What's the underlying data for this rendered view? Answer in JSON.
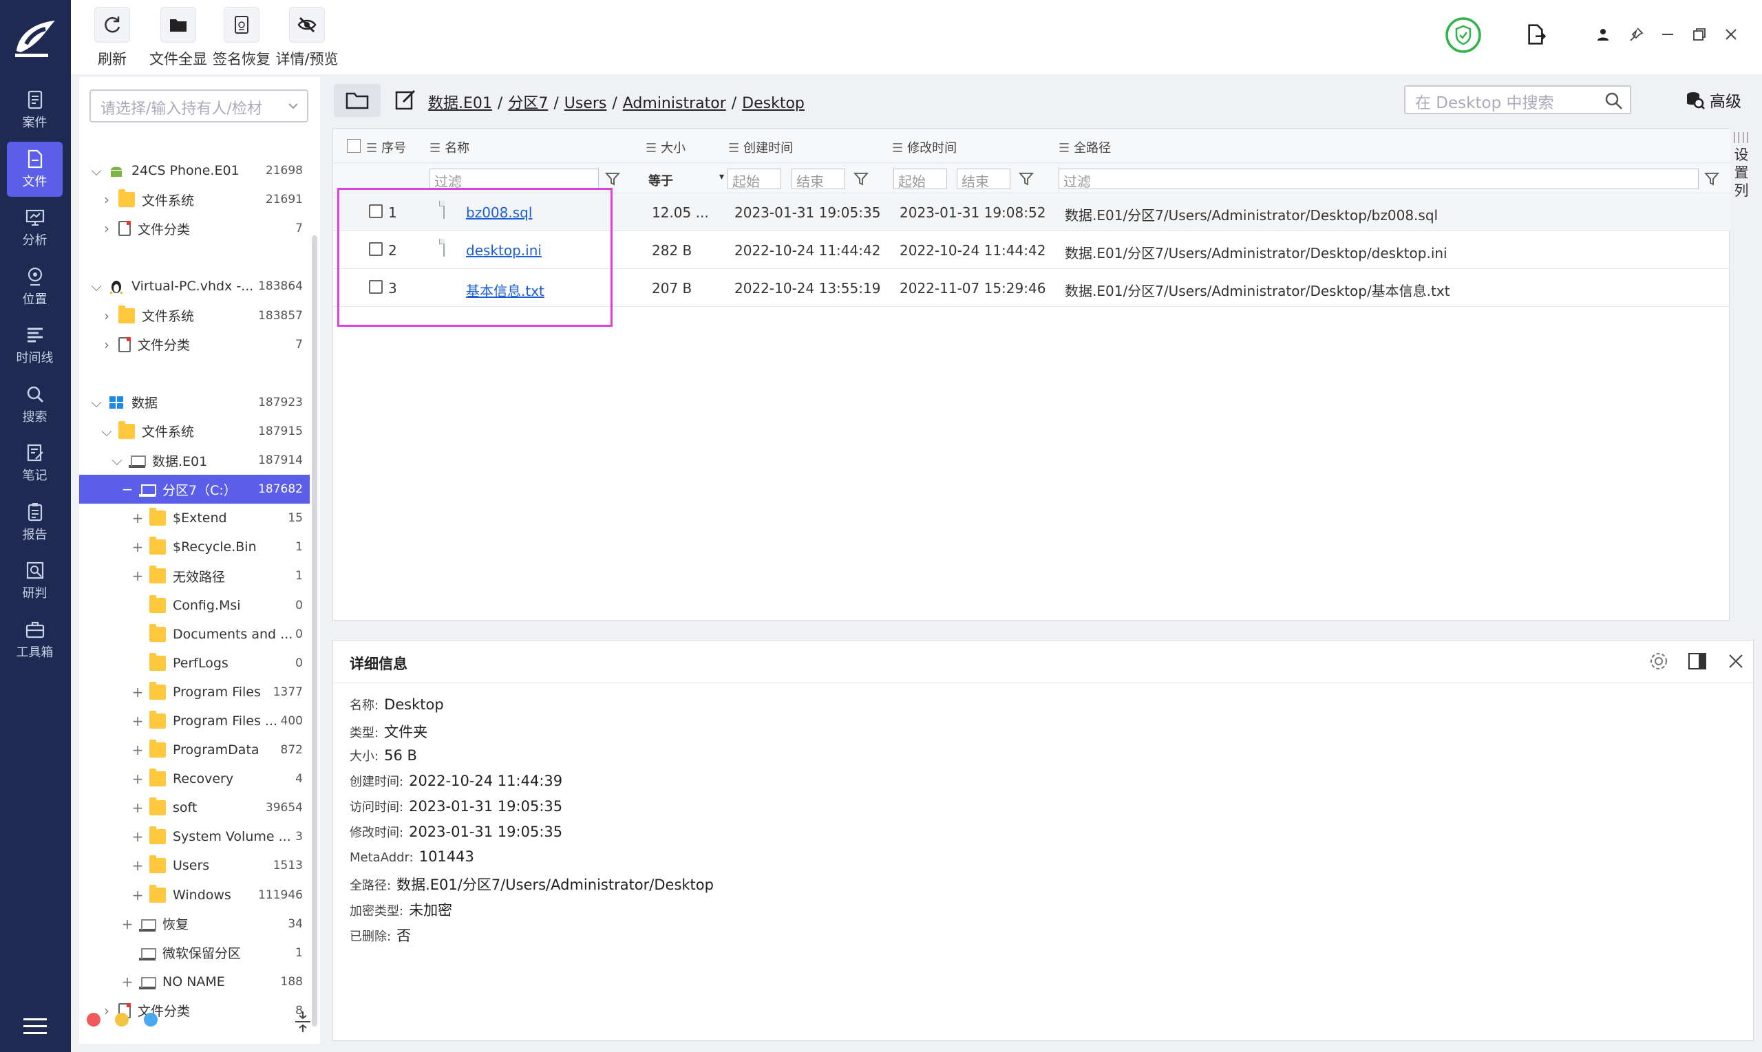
{
  "nav": {
    "items": [
      {
        "label": "案件",
        "icon": "case-icon"
      },
      {
        "label": "文件",
        "icon": "file-icon",
        "active": true
      },
      {
        "label": "分析",
        "icon": "analysis-icon"
      },
      {
        "label": "位置",
        "icon": "location-icon"
      },
      {
        "label": "时间线",
        "icon": "timeline-icon"
      },
      {
        "label": "搜索",
        "icon": "search-icon"
      },
      {
        "label": "笔记",
        "icon": "note-icon"
      },
      {
        "label": "报告",
        "icon": "report-icon"
      },
      {
        "label": "研判",
        "icon": "judge-icon"
      },
      {
        "label": "工具箱",
        "icon": "toolbox-icon"
      }
    ]
  },
  "toolbar": {
    "refresh": "刷新",
    "show_all": "文件全显",
    "sign_recover": "签名恢复",
    "detail_preview": "详情/预览"
  },
  "tree": {
    "search_placeholder": "请选择/输入持有人/检材",
    "nodes": [
      {
        "toggle": "⌵",
        "icon": "android",
        "label": "24CS Phone.E01",
        "count": "21698"
      },
      {
        "toggle": "›",
        "icon": "folder",
        "label": "文件系统",
        "count": "21691"
      },
      {
        "toggle": "›",
        "icon": "fcat",
        "label": "文件分类",
        "count": "7"
      },
      {
        "toggle": "⌵",
        "icon": "linux",
        "label": "Virtual-PC.vhdx -...",
        "count": "183864"
      },
      {
        "toggle": "›",
        "icon": "folder",
        "label": "文件系统",
        "count": "183857"
      },
      {
        "toggle": "›",
        "icon": "fcat",
        "label": "文件分类",
        "count": "7"
      },
      {
        "toggle": "⌵",
        "icon": "windows",
        "label": "数据",
        "count": "187923"
      },
      {
        "toggle": "⌵",
        "icon": "folder",
        "label": "文件系统",
        "count": "187915"
      },
      {
        "toggle": "⌵",
        "icon": "disk",
        "label": "数据.E01",
        "count": "187914"
      },
      {
        "toggle": "−",
        "icon": "disk",
        "label": "分区7（C:）",
        "count": "187682",
        "selected": true
      },
      {
        "toggle": "+",
        "icon": "folder",
        "label": "$Extend",
        "count": "15"
      },
      {
        "toggle": "+",
        "icon": "folder",
        "label": "$Recycle.Bin",
        "count": "1"
      },
      {
        "toggle": "+",
        "icon": "folder",
        "label": "无效路径",
        "count": "1"
      },
      {
        "toggle": "",
        "icon": "folder",
        "label": "Config.Msi",
        "count": "0"
      },
      {
        "toggle": "",
        "icon": "folder",
        "label": "Documents and ...",
        "count": "0"
      },
      {
        "toggle": "",
        "icon": "folder",
        "label": "PerfLogs",
        "count": "0"
      },
      {
        "toggle": "+",
        "icon": "folder",
        "label": "Program Files",
        "count": "1377"
      },
      {
        "toggle": "+",
        "icon": "folder",
        "label": "Program Files ...",
        "count": "400"
      },
      {
        "toggle": "+",
        "icon": "folder",
        "label": "ProgramData",
        "count": "872"
      },
      {
        "toggle": "+",
        "icon": "folder",
        "label": "Recovery",
        "count": "4"
      },
      {
        "toggle": "+",
        "icon": "folder",
        "label": "soft",
        "count": "39654"
      },
      {
        "toggle": "+",
        "icon": "folder",
        "label": "System Volume ...",
        "count": "3"
      },
      {
        "toggle": "+",
        "icon": "folder",
        "label": "Users",
        "count": "1513"
      },
      {
        "toggle": "+",
        "icon": "folder",
        "label": "Windows",
        "count": "111946"
      },
      {
        "toggle": "+",
        "icon": "disk",
        "label": "恢复",
        "count": "34"
      },
      {
        "toggle": "",
        "icon": "disk",
        "label": "微软保留分区",
        "count": "1"
      },
      {
        "toggle": "+",
        "icon": "disk",
        "label": "NO NAME",
        "count": "188"
      },
      {
        "toggle": "›",
        "icon": "fcat",
        "label": "文件分类",
        "count": "8"
      }
    ]
  },
  "path": {
    "crumbs": [
      "数据.E01",
      "分区7",
      "Users",
      "Administrator",
      "Desktop"
    ],
    "search_placeholder": "在 Desktop 中搜索",
    "advanced": "高级"
  },
  "table": {
    "headers": {
      "seq": "序号",
      "name": "名称",
      "size": "大小",
      "ctime": "创建时间",
      "mtime": "修改时间",
      "path": "全路径"
    },
    "filters": {
      "name": "过滤",
      "size_op": "等于",
      "c_start": "起始",
      "c_end": "结束",
      "m_start": "起始",
      "m_end": "结束",
      "path": "过滤"
    },
    "rows": [
      {
        "seq": "1",
        "name": "bz008.sql",
        "size": "12.05 ...",
        "ctime": "2023-01-31 19:05:35",
        "mtime": "2023-01-31 19:08:52",
        "path": "数据.E01/分区7/Users/Administrator/Desktop/bz008.sql",
        "type": "doc"
      },
      {
        "seq": "2",
        "name": "desktop.ini",
        "size": "282 B",
        "ctime": "2022-10-24 11:44:42",
        "mtime": "2022-10-24 11:44:42",
        "path": "数据.E01/分区7/Users/Administrator/Desktop/desktop.ini",
        "type": "doc"
      },
      {
        "seq": "3",
        "name": "基本信息.txt",
        "size": "207 B",
        "ctime": "2022-10-24 13:55:19",
        "mtime": "2022-11-07 15:29:46",
        "path": "数据.E01/分区7/Users/Administrator/Desktop/基本信息.txt",
        "type": "txt"
      }
    ],
    "column_settings": "设置列"
  },
  "detail": {
    "title": "详细信息",
    "fields": [
      {
        "k": "名称:",
        "v": "Desktop"
      },
      {
        "k": "类型:",
        "v": "文件夹"
      },
      {
        "k": "大小:",
        "v": "56 B"
      },
      {
        "k": "创建时间:",
        "v": "2022-10-24 11:44:39"
      },
      {
        "k": "访问时间:",
        "v": "2023-01-31 19:05:35"
      },
      {
        "k": "修改时间:",
        "v": "2023-01-31 19:05:35"
      },
      {
        "k": "MetaAddr:",
        "v": "101443"
      },
      {
        "k": "全路径:",
        "v": "数据.E01/分区7/Users/Administrator/Desktop"
      },
      {
        "k": "加密类型:",
        "v": "未加密"
      },
      {
        "k": "已删除:",
        "v": "否"
      }
    ]
  },
  "colors": {
    "nav_bg": "#1e2a52",
    "accent": "#5a5ee8",
    "highlight": "#e040e0",
    "link": "#1a5fd8",
    "shield": "#2fb34a"
  }
}
